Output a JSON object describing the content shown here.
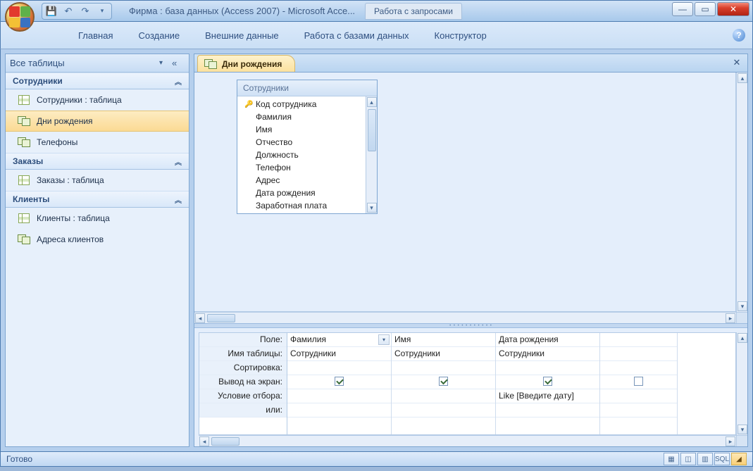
{
  "title": "Фирма : база данных (Access 2007)  -  Microsoft Acce...",
  "context_tab": "Работа с запросами",
  "ribbon_tabs": {
    "t0": "Главная",
    "t1": "Создание",
    "t2": "Внешние данные",
    "t3": "Работа с базами данных",
    "t4": "Конструктор"
  },
  "nav": {
    "header": "Все таблицы",
    "groups": [
      {
        "title": "Сотрудники",
        "items": [
          {
            "label": "Сотрудники : таблица",
            "type": "table"
          },
          {
            "label": "Дни рождения",
            "type": "query",
            "selected": true
          },
          {
            "label": "Телефоны",
            "type": "query"
          }
        ]
      },
      {
        "title": "Заказы",
        "items": [
          {
            "label": "Заказы : таблица",
            "type": "table"
          }
        ]
      },
      {
        "title": "Клиенты",
        "items": [
          {
            "label": "Клиенты : таблица",
            "type": "table"
          },
          {
            "label": "Адреса клиентов",
            "type": "query"
          }
        ]
      }
    ]
  },
  "doc_tab": "Дни рождения",
  "fieldlist": {
    "title": "Сотрудники",
    "fields": [
      "Код сотрудника",
      "Фамилия",
      "Имя",
      "Отчество",
      "Должность",
      "Телефон",
      "Адрес",
      "Дата рождения",
      "Заработная плата"
    ]
  },
  "grid": {
    "rowlabels": {
      "r0": "Поле:",
      "r1": "Имя таблицы:",
      "r2": "Сортировка:",
      "r3": "Вывод на экран:",
      "r4": "Условие отбора:",
      "r5": "или:"
    },
    "cols": [
      {
        "field": "Фамилия",
        "table": "Сотрудники",
        "sort": "",
        "show": true,
        "crit": "",
        "or": "",
        "dropdown": true
      },
      {
        "field": "Имя",
        "table": "Сотрудники",
        "sort": "",
        "show": true,
        "crit": "",
        "or": ""
      },
      {
        "field": "Дата рождения",
        "table": "Сотрудники",
        "sort": "",
        "show": true,
        "crit": "Like [Введите дату]",
        "or": ""
      }
    ]
  },
  "status": "Готово",
  "view_sql": "SQL"
}
